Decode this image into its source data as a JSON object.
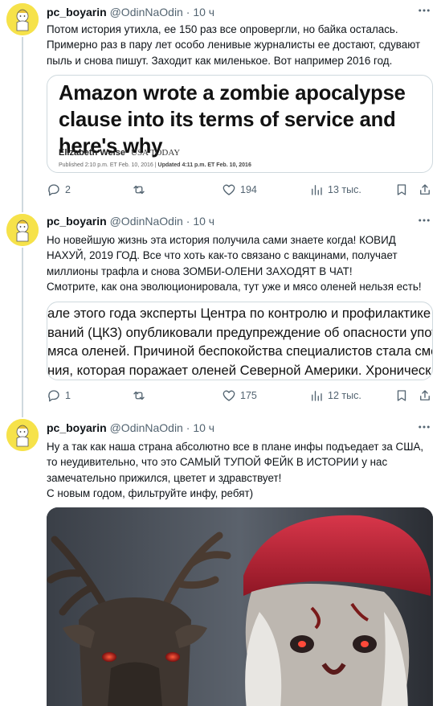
{
  "tweets": [
    {
      "author_name": "pc_boyarin",
      "handle": "@OdinNaOdin",
      "dot": "·",
      "time": "10 ч",
      "text": "Потом история утихла, ее 150 раз все опровергли, но байка осталась.\nПримерно раз в пару лет особо ленивые журналисты ее достают, сдувают пыль и снова пишут. Заходит как миленькое. Вот например 2016 год.",
      "card": {
        "headline": "Amazon wrote a zombie apocalypse clause into its terms of service and here's why",
        "author": "Elizabeth Weise",
        "publication": "USA TODAY",
        "published": "Published 2:10 p.m. ET Feb. 10, 2016",
        "separator": "|",
        "updated": "Updated 4:11 p.m. ET Feb. 10, 2016"
      },
      "stats": {
        "replies": "2",
        "reposts": "",
        "likes": "194",
        "views": "13 тыс."
      }
    },
    {
      "author_name": "pc_boyarin",
      "handle": "@OdinNaOdin",
      "dot": "·",
      "time": "10 ч",
      "text": "Но новейшую жизнь эта история получила сами знаете когда! КОВИД НАХУЙ, 2019 ГОД. Все что хоть как-то связано с вакцинами, получает миллионы трафла и снова ЗОМБИ-ОЛЕНИ ЗАХОДЯТ В ЧАТ!\nСмотрите, как она эволюционировала, тут уже и мясо оленей нельзя есть!",
      "quote_lines": [
        "але этого года эксперты Центра по контролю и профилактике",
        "ваний (ЦКЗ) опубликовали предупреждение об опасности употребл",
        " мяса оленей. Причиной беспокойства специалистов стала смерте",
        "ния, которая поражает оленей Северной Америки. Хроническая"
      ],
      "stats": {
        "replies": "1",
        "reposts": "",
        "likes": "175",
        "views": "12 тыс."
      }
    },
    {
      "author_name": "pc_boyarin",
      "handle": "@OdinNaOdin",
      "dot": "·",
      "time": "10 ч",
      "text": "Ну а так как наша страна абсолютно все в плане инфы подъедает за США, то неудивительно, что это САМЫЙ ТУПОЙ ФЕЙК В ИСТОРИИ у нас замечательно прижился, цветет и здравствует!\nС новым годом, фильтруйте инфу, ребят)"
    }
  ],
  "icons": {
    "more": "more-horizontal-icon",
    "reply": "reply-icon",
    "repost": "repost-icon",
    "like": "heart-icon",
    "views": "views-chart-icon",
    "bookmark": "bookmark-icon",
    "share": "share-icon"
  },
  "colors": {
    "text": "#0f1419",
    "secondary": "#536471",
    "border": "#cfd9de",
    "avatar_bg": "#f6e24a",
    "hat_red": "#c4283a"
  }
}
